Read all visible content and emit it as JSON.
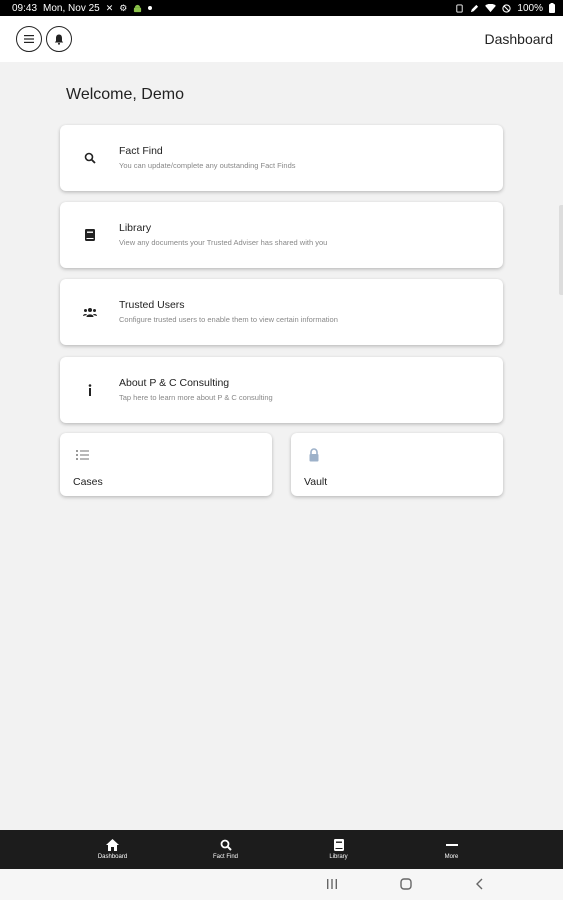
{
  "status": {
    "time": "09:43",
    "date": "Mon, Nov 25",
    "battery": "100%"
  },
  "header": {
    "title": "Dashboard",
    "menu_icon": "hamburger-icon",
    "bell_icon": "bell-icon"
  },
  "welcome": "Welcome, Demo",
  "cards": [
    {
      "title": "Fact Find",
      "subtitle": "You can update/complete any outstanding Fact Finds",
      "icon": "search-icon"
    },
    {
      "title": "Library",
      "subtitle": "View any documents your Trusted Adviser has shared with you",
      "icon": "book-icon"
    },
    {
      "title": "Trusted Users",
      "subtitle": "Configure trusted users to enable them to view certain information",
      "icon": "users-icon"
    },
    {
      "title": "About P & C Consulting",
      "subtitle": "Tap here to learn more about P & C consulting",
      "icon": "info-icon"
    }
  ],
  "small_cards": [
    {
      "label": "Cases",
      "icon": "list-icon"
    },
    {
      "label": "Vault",
      "icon": "lock-icon"
    }
  ],
  "bottom_nav": [
    {
      "label": "Dashboard",
      "icon": "home-icon"
    },
    {
      "label": "Fact Find",
      "icon": "search-icon"
    },
    {
      "label": "Library",
      "icon": "book-icon"
    },
    {
      "label": "More",
      "icon": "more-icon"
    }
  ],
  "colors": {
    "background": "#f2f2f2",
    "nav_background": "#1c1c1c",
    "vault_icon": "#9db1c9"
  }
}
